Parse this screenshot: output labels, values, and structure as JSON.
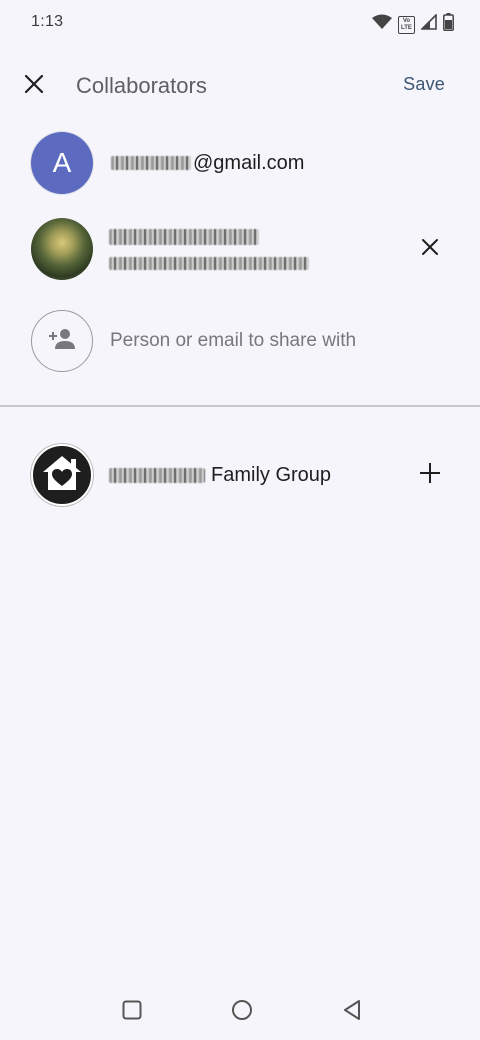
{
  "status_bar": {
    "time": "1:13",
    "icons": [
      "wifi-icon",
      "volte-icon",
      "signal-icon",
      "battery-icon"
    ],
    "volte_line1": "Vo",
    "volte_line2": "LTE"
  },
  "app_bar": {
    "title": "Collaborators",
    "save_label": "Save",
    "close_icon": "close-icon"
  },
  "owner": {
    "avatar_letter": "A",
    "email_suffix": "@gmail.com"
  },
  "collaborator": {
    "remove_icon": "close-icon"
  },
  "share": {
    "placeholder": "Person or email to share with",
    "icon": "person-add-icon"
  },
  "family_group": {
    "label": "Family Group",
    "icon": "home-heart-icon",
    "add_icon": "plus-icon"
  },
  "nav_bar": {
    "items": [
      "recents-square-icon",
      "home-circle-icon",
      "back-triangle-icon"
    ]
  },
  "colors": {
    "background": "#f6f5fb",
    "avatar_letter_bg": "#5c6bc0",
    "save_text": "#3c5674"
  }
}
